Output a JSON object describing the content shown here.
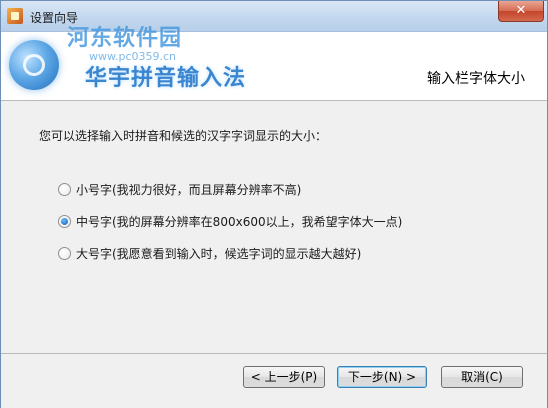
{
  "window": {
    "title": "设置向导",
    "close_label": "✕"
  },
  "header": {
    "watermark_name": "河东软件园",
    "watermark_url": "www.pc0359.cn",
    "product_name": "华宇拼音输入法",
    "page_title": "输入栏字体大小"
  },
  "content": {
    "prompt": "您可以选择输入时拼音和候选的汉字字词显示的大小：",
    "options": [
      {
        "label": "小号字(我视力很好，而且屏幕分辨率不高)",
        "checked": false
      },
      {
        "label": "中号字(我的屏幕分辨率在800x600以上，我希望字体大一点)",
        "checked": true
      },
      {
        "label": "大号字(我愿意看到输入时，候选字词的显示越大越好)",
        "checked": false
      }
    ]
  },
  "footer": {
    "back_label": "< 上一步(P)",
    "next_label": "下一步(N) >",
    "cancel_label": "取消(C)"
  },
  "colors": {
    "accent": "#3a86d0",
    "radio_selected": "#1b6fc5",
    "close_button": "#c4452a"
  }
}
